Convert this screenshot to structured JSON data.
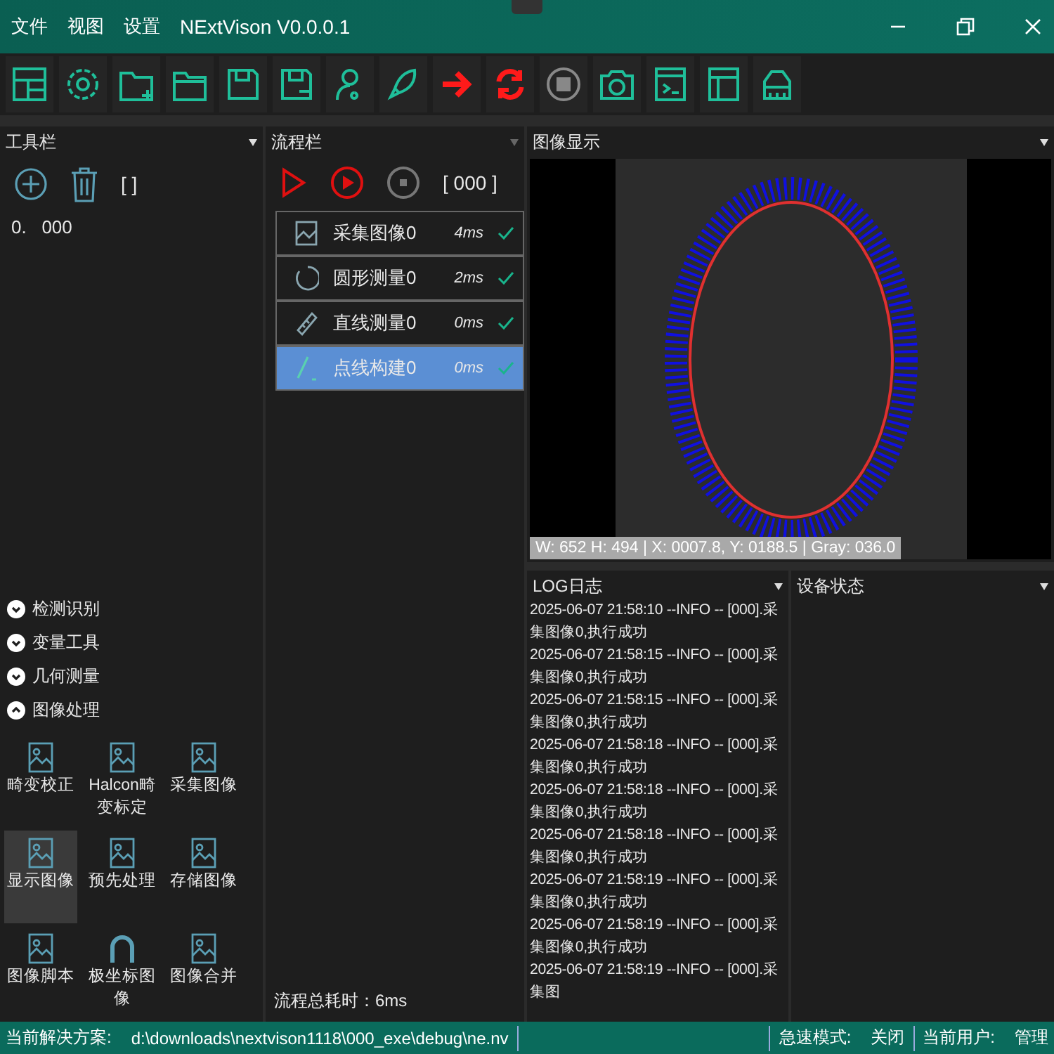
{
  "window": {
    "menu": [
      {
        "label": "文件"
      },
      {
        "label": "视图"
      },
      {
        "label": "设置"
      }
    ],
    "title": "NExtVison V0.0.0.1"
  },
  "toolbox": {
    "title": "工具栏",
    "bracket": "[    ]",
    "items": [
      {
        "index": "0.",
        "label": "000"
      }
    ],
    "categories": [
      {
        "label": "检测识别",
        "expanded": false
      },
      {
        "label": "变量工具",
        "expanded": false
      },
      {
        "label": "几何测量",
        "expanded": false
      },
      {
        "label": "图像处理",
        "expanded": true,
        "tools": [
          {
            "label": "畸变校正",
            "selected": false
          },
          {
            "label": "Halcon畸变标定",
            "selected": false
          },
          {
            "label": "采集图像",
            "selected": false
          },
          {
            "label": "显示图像",
            "selected": true
          },
          {
            "label": "预先处理",
            "selected": false
          },
          {
            "label": "存储图像",
            "selected": false
          },
          {
            "label": "图像脚本",
            "selected": false
          },
          {
            "label": "极坐标图像",
            "selected": false
          },
          {
            "label": "图像合并",
            "selected": false
          }
        ]
      }
    ]
  },
  "flow": {
    "title": "流程栏",
    "counter": "[ 000 ]",
    "steps": [
      {
        "kind": "capture",
        "name": "采集图像0",
        "time": "4ms",
        "success": true,
        "selected": false
      },
      {
        "kind": "circle",
        "name": "圆形测量0",
        "time": "2ms",
        "success": true,
        "selected": false
      },
      {
        "kind": "line",
        "name": "直线测量0",
        "time": "0ms",
        "success": true,
        "selected": false
      },
      {
        "kind": "point",
        "name": "点线构建0",
        "time": "0ms",
        "success": true,
        "selected": true
      }
    ],
    "total": "流程总耗时：6ms"
  },
  "image_panel": {
    "title": "图像显示",
    "info": "W: 652 H: 494 | X: 0007.8, Y: 0188.5 | Gray: 036.0"
  },
  "log": {
    "title": "LOG日志",
    "entries": [
      "2025-06-07 21:58:10 --INFO -- [000].采集图像0,执行成功",
      "2025-06-07 21:58:15 --INFO -- [000].采集图像0,执行成功",
      "2025-06-07 21:58:15 --INFO -- [000].采集图像0,执行成功",
      "2025-06-07 21:58:18 --INFO -- [000].采集图像0,执行成功",
      "2025-06-07 21:58:18 --INFO -- [000].采集图像0,执行成功",
      "2025-06-07 21:58:18 --INFO -- [000].采集图像0,执行成功",
      "2025-06-07 21:58:19 --INFO -- [000].采集图像0,执行成功",
      "2025-06-07 21:58:19 --INFO -- [000].采集图像0,执行成功",
      "2025-06-07 21:58:19 --INFO -- [000].采集图"
    ]
  },
  "device_panel": {
    "title": "设备状态"
  },
  "status_bar": {
    "solution_label": "当前解决方案:",
    "solution_path": "d:\\downloads\\nextvison1118\\000_exe\\debug\\ne.nv",
    "speed_label": "急速模式:",
    "speed_value": "关闭",
    "user_label": "当前用户:",
    "user_value": "管理"
  }
}
